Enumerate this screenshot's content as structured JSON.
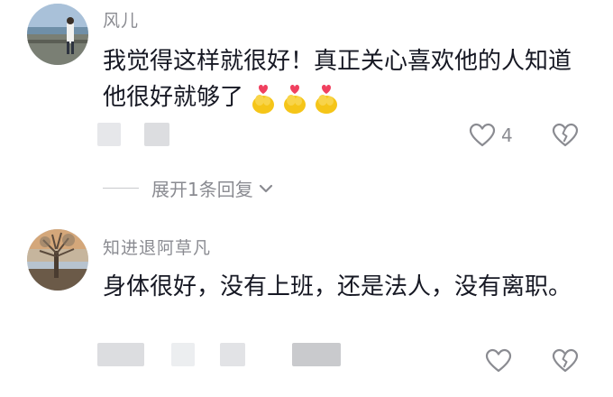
{
  "comments": [
    {
      "username": "风儿",
      "text": "我觉得这样就很好！真正关心喜欢他的人知道他很好就够了",
      "emoji_count": 3,
      "likes": "4",
      "expand_label": "展开1条回复"
    },
    {
      "username": "知进退阿草凡",
      "text": "身体很好，没有上班，还是法人，没有离职。",
      "likes": ""
    }
  ],
  "icons": {
    "like": "heart-outline-icon",
    "dislike": "broken-heart-icon",
    "expand": "chevron-down-icon",
    "emoji": "finger-heart-emoji"
  },
  "colors": {
    "text": "#161823",
    "muted": "#8a8b91",
    "emoji_yellow": "#f5c518",
    "emoji_heart": "#f0405f"
  }
}
